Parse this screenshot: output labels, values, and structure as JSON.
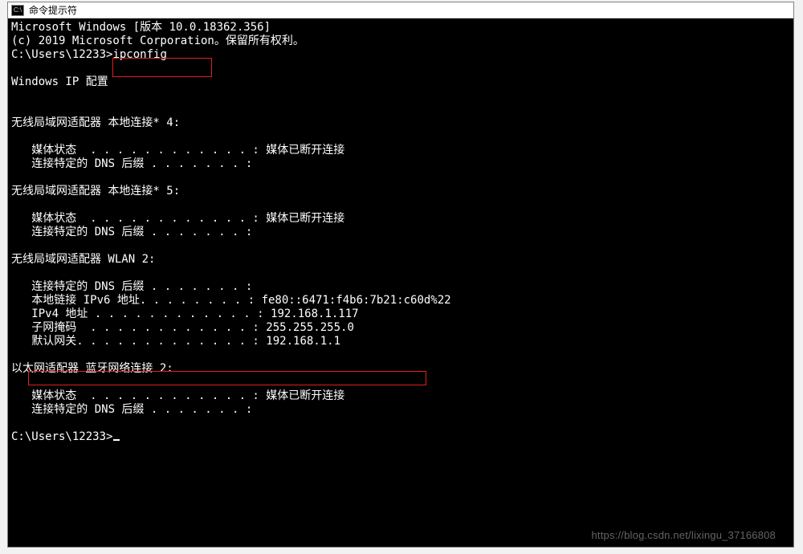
{
  "window": {
    "title": "命令提示符"
  },
  "term": {
    "l1": "Microsoft Windows [版本 10.0.18362.356]",
    "l2": "(c) 2019 Microsoft Corporation。保留所有权利。",
    "blank": "",
    "prompt1_a": "C:\\Users\\12233>",
    "prompt1_b": "ipconfig",
    "l5": "Windows IP 配置",
    "ad1_head": "无线局域网适配器 本地连接* 4:",
    "ad1_l1a": "   媒体状态  . . . . . . . . . . . . : ",
    "ad1_l1b": "媒体已断开连接",
    "ad1_l2": "   连接特定的 DNS 后缀 . . . . . . . :",
    "ad2_head": "无线局域网适配器 本地连接* 5:",
    "ad2_l1a": "   媒体状态  . . . . . . . . . . . . : ",
    "ad2_l1b": "媒体已断开连接",
    "ad2_l2": "   连接特定的 DNS 后缀 . . . . . . . :",
    "ad3_head": "无线局域网适配器 WLAN 2:",
    "ad3_l1": "   连接特定的 DNS 后缀 . . . . . . . :",
    "ad3_l2a": "   本地链接 IPv6 地址. . . . . . . . : ",
    "ad3_l2b": "fe80::6471:f4b6:7b21:c60d%22",
    "ad3_l3a": "   IPv4 地址 . . . . . . . . . . . . : ",
    "ad3_l3b": "192.168.1.117",
    "ad3_l4a": "   子网掩码  . . . . . . . . . . . . : ",
    "ad3_l4b": "255.255.255.0",
    "ad3_l5a": "   默认网关. . . . . . . . . . . . . : ",
    "ad3_l5b": "192.168.1.1",
    "ad4_head": "以太网适配器 蓝牙网络连接 2:",
    "ad4_l1a": "   媒体状态  . . . . . . . . . . . . : ",
    "ad4_l1b": "媒体已断开连接",
    "ad4_l2": "   连接特定的 DNS 后缀 . . . . . . . :",
    "prompt2": "C:\\Users\\12233>"
  },
  "watermark": "https://blog.csdn.net/lixingu_37166808"
}
